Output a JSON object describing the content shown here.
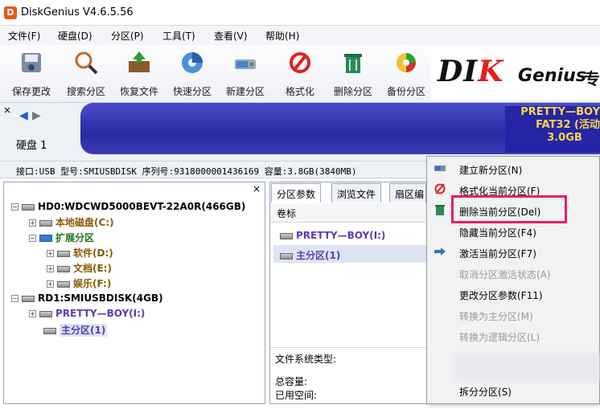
{
  "window": {
    "title": "DiskGenius V4.6.5.56",
    "icon": "app-icon-d"
  },
  "menu": [
    "文件(F)",
    "硬盘(D)",
    "分区(P)",
    "工具(T)",
    "查看(V)",
    "帮助(H)"
  ],
  "toolbar": [
    {
      "label": "保存更改",
      "icon": "save-disk-icon"
    },
    {
      "label": "搜索分区",
      "icon": "magnifier-icon"
    },
    {
      "label": "恢复文件",
      "icon": "recover-box-icon"
    },
    {
      "label": "快速分区",
      "icon": "quick-partition-icon"
    },
    {
      "label": "新建分区",
      "icon": "new-partition-icon"
    },
    {
      "label": "格式化",
      "icon": "format-icon"
    },
    {
      "label": "删除分区",
      "icon": "trash-icon"
    },
    {
      "label": "备份分区",
      "icon": "backup-icon"
    }
  ],
  "logo": {
    "text_main": "DI",
    "text_k": "K",
    "text_sub": "Genius",
    "text_tail": "专"
  },
  "disk_strip": {
    "close": "×",
    "label": "硬盘 1",
    "partition": {
      "name": "PRETTY—BOY",
      "fs": "FAT32 (活动",
      "size": "3.0GB"
    }
  },
  "info_bar": "接口:USB  型号:SMIUSBDISK  序列号:9318000001436169  容量:3.8GB(3840MB)",
  "tree": {
    "close": "×",
    "items": [
      {
        "label": "HD0:WDCWD5000BEVT-22A0R(466GB)",
        "color": "#000000"
      },
      {
        "label": "本地磁盘(C:)",
        "color": "#8b5a00"
      },
      {
        "label": "扩展分区",
        "color": "#1d7a1d"
      },
      {
        "label": "软件(D:)",
        "color": "#8b5a00"
      },
      {
        "label": "文档(E:)",
        "color": "#8b5a00"
      },
      {
        "label": "娱乐(F:)",
        "color": "#8b5a00"
      },
      {
        "label": "RD1:SMIUSBDISK(4GB)",
        "color": "#000000"
      },
      {
        "label": "PRETTY—BOY(I:)",
        "color": "#5b3bb5"
      },
      {
        "label": "主分区(1)",
        "color": "#5b3bb5"
      }
    ]
  },
  "right_panel": {
    "tabs": [
      "分区参数",
      "浏览文件",
      "扇区编"
    ],
    "column_header": "卷标",
    "volumes": [
      {
        "label": "PRETTY—BOY(I:)"
      },
      {
        "label": "主分区(1)"
      }
    ],
    "fs_label": "文件系统类型:",
    "total_label": "总容量:",
    "used_label": "已用空间:"
  },
  "context_menu": [
    {
      "label": "建立新分区(N)",
      "icon": "new-partition-icon",
      "disabled": false
    },
    {
      "label": "格式化当前分区(F)",
      "icon": "format-icon",
      "disabled": false
    },
    {
      "label": "删除当前分区(Del)",
      "icon": "trash-icon",
      "disabled": false
    },
    {
      "label": "隐藏当前分区(F4)",
      "icon": "",
      "disabled": false
    },
    {
      "label": "激活当前分区(F7)",
      "icon": "activate-icon",
      "disabled": false
    },
    {
      "label": "取消分区激活状态(A)",
      "icon": "",
      "disabled": true
    },
    {
      "label": "更改分区参数(F11)",
      "icon": "",
      "disabled": false
    },
    {
      "label": "转换为主分区(M)",
      "icon": "",
      "disabled": true
    },
    {
      "label": "转换为逻辑分区(L)",
      "icon": "",
      "disabled": true
    },
    {
      "label": "",
      "icon": "",
      "disabled": true
    },
    {
      "label": "",
      "icon": "",
      "disabled": true
    },
    {
      "label": "拆分分区(S)",
      "icon": "",
      "disabled": false
    }
  ],
  "colors": {
    "highlight": "#e91e63",
    "disk_bar": "#2b2aa2",
    "partition_text": "#ffd54a"
  }
}
